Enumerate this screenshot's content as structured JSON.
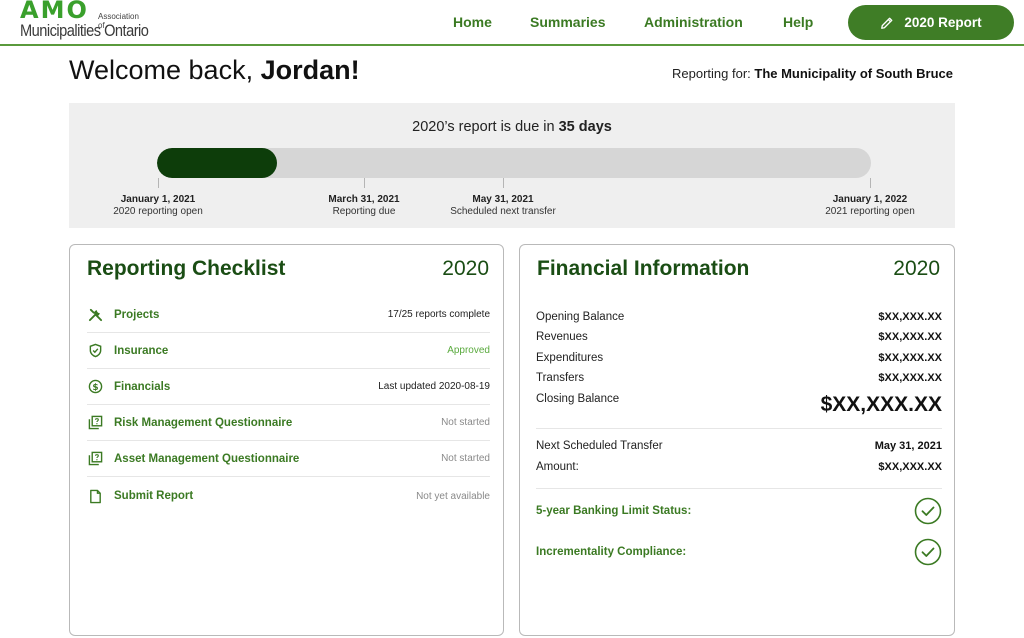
{
  "brand": {
    "logo_mark": "AMO",
    "logo_small_line1": "Association of",
    "logo_main": "Municipalities Ontario",
    "accent_color": "#3f7d26",
    "dark_color": "#0d3d0a"
  },
  "nav": {
    "home": "Home",
    "summaries": "Summaries",
    "administration": "Administration",
    "help": "Help",
    "report_button": "2020 Report",
    "report_button_icon": "pencil-icon"
  },
  "welcome": {
    "greeting": "Welcome back, ",
    "name": "Jordan!",
    "reporting_for_label": "Reporting for: ",
    "municipality": "The Municipality of South Bruce"
  },
  "timeline": {
    "due_prefix": "2020’s report is due in ",
    "due_days": "35 days",
    "progress_fraction": 0.168,
    "milestones": [
      {
        "date": "January 1, 2021",
        "desc": "2020 reporting open"
      },
      {
        "date": "March 31, 2021",
        "desc": "Reporting due"
      },
      {
        "date": "May 31, 2021",
        "desc": "Scheduled next transfer"
      },
      {
        "date": "January 1, 2022",
        "desc": "2021 reporting open"
      }
    ]
  },
  "checklist": {
    "title": "Reporting Checklist",
    "year": "2020",
    "items": [
      {
        "label": "Projects",
        "status": "17/25 reports complete",
        "icon": "tools-icon"
      },
      {
        "label": "Insurance",
        "status": "Approved",
        "icon": "shield-check-icon"
      },
      {
        "label": "Financials",
        "status": "Last updated 2020-08-19",
        "icon": "dollar-circle-icon"
      },
      {
        "label": "Risk Management Questionnaire",
        "status": "Not started",
        "icon": "questionnaire-icon"
      },
      {
        "label": "Asset Management Questionnaire",
        "status": "Not started",
        "icon": "questionnaire-icon"
      },
      {
        "label": "Submit Report",
        "status": "Not yet available",
        "icon": "document-icon"
      }
    ]
  },
  "financial": {
    "title": "Financial Information",
    "year": "2020",
    "opening_balance_label": "Opening Balance",
    "opening_balance_value": "$XX,XXX.XX",
    "revenues_label": "Revenues",
    "revenues_value": "$XX,XXX.XX",
    "expenditures_label": "Expenditures",
    "expenditures_value": "$XX,XXX.XX",
    "transfers_label": "Transfers",
    "transfers_value": "$XX,XXX.XX",
    "closing_balance_label": "Closing Balance",
    "closing_balance_value": "$XX,XXX.XX",
    "next_transfer_label": "Next Scheduled Transfer",
    "next_transfer_value": "May 31, 2021",
    "amount_label": "Amount:",
    "amount_value": "$XX,XXX.XX",
    "banking_limit_label": "5-year Banking Limit Status:",
    "incrementality_label": "Incrementality Compliance:"
  }
}
